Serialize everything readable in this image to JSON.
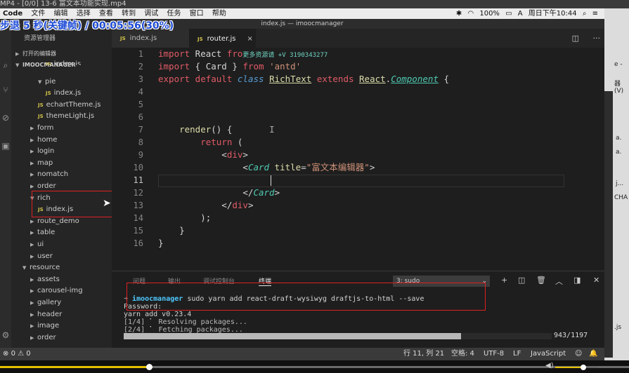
{
  "player": {
    "title": "MP4 - [0/0] 13-6 富文本功能实现.mp4",
    "seek_overlay": "步退 5 秒(关键帧) / 00:05:56(30%)",
    "progress": 0.24,
    "volume": 0.6
  },
  "menubar": {
    "items": [
      "Code",
      "文件",
      "编辑",
      "选择",
      "查看",
      "转到",
      "调试",
      "任务",
      "窗口",
      "帮助"
    ],
    "battery": "100%",
    "clock": "周日下午10:44"
  },
  "window": {
    "title": "index.js — imoocmanager"
  },
  "sidebar": {
    "title": "资源管理器",
    "sections": [
      "打开的编辑器",
      "IMOOCMANAGER"
    ],
    "tree": [
      {
        "label": "index.js",
        "file": true,
        "depth": 5,
        "cut": true
      },
      {
        "label": "pie",
        "file": false,
        "depth": 4,
        "open": true
      },
      {
        "label": "index.js",
        "file": true,
        "depth": 5
      },
      {
        "label": "echartTheme.js",
        "file": true,
        "depth": 4
      },
      {
        "label": "themeLight.js",
        "file": true,
        "depth": 4
      },
      {
        "label": "form",
        "file": false,
        "depth": 3
      },
      {
        "label": "home",
        "file": false,
        "depth": 3
      },
      {
        "label": "login",
        "file": false,
        "depth": 3
      },
      {
        "label": "map",
        "file": false,
        "depth": 3
      },
      {
        "label": "nomatch",
        "file": false,
        "depth": 3
      },
      {
        "label": "order",
        "file": false,
        "depth": 3
      },
      {
        "label": "rich",
        "file": false,
        "depth": 3,
        "open": true
      },
      {
        "label": "index.js",
        "file": true,
        "depth": 4
      },
      {
        "label": "route_demo",
        "file": false,
        "depth": 3
      },
      {
        "label": "table",
        "file": false,
        "depth": 3
      },
      {
        "label": "ui",
        "file": false,
        "depth": 3
      },
      {
        "label": "user",
        "file": false,
        "depth": 3
      },
      {
        "label": "resource",
        "file": false,
        "depth": 2,
        "open": true
      },
      {
        "label": "assets",
        "file": false,
        "depth": 3
      },
      {
        "label": "carousel-img",
        "file": false,
        "depth": 3
      },
      {
        "label": "gallery",
        "file": false,
        "depth": 3
      },
      {
        "label": "header",
        "file": false,
        "depth": 3
      },
      {
        "label": "image",
        "file": false,
        "depth": 3
      },
      {
        "label": "order",
        "file": false,
        "depth": 3
      }
    ]
  },
  "tabs": [
    {
      "label": "index.js",
      "close": "×"
    },
    {
      "label": "router.js",
      "close": "×"
    }
  ],
  "editor": {
    "line_numbers": [
      "1",
      "2",
      "3",
      "4",
      "5",
      "6",
      "7",
      "8",
      "9",
      "10",
      "11",
      "12",
      "13",
      "14",
      "15",
      "16"
    ],
    "watermark": "更多资源请 +V 3190343277"
  },
  "panel": {
    "tabs": [
      "问题",
      "输出",
      "调试控制台",
      "终端"
    ],
    "terminal_select": "3: sudo",
    "prompt_dir": "imoocmanager",
    "command": " sudo yarn add react-draft-wysiwyg draftjs-to-html --save",
    "lines": [
      "Password:",
      "yarn add v0.23.4",
      "[1/4] ⠁ Resolving packages...",
      "[2/4] ⠁ Fetching packages..."
    ],
    "progress_count": "943/1197",
    "progress": 0.788
  },
  "status": {
    "errors": "0",
    "warnings": "0",
    "position": "行 11, 列 21",
    "spaces": "空格: 4",
    "encoding": "UTF-8",
    "eol": "LF",
    "language": "JavaScript"
  },
  "right_strip": [
    "e -",
    "器(V)",
    "a.",
    "a.",
    "j...",
    "CHA",
    ".js"
  ]
}
